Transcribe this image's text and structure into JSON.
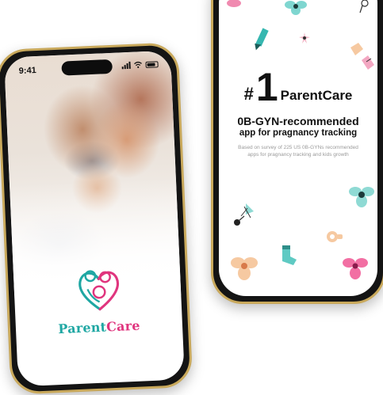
{
  "left_screen": {
    "status": {
      "time": "9:41"
    },
    "brand": {
      "part1": "Parent",
      "part2": "Care"
    }
  },
  "right_screen": {
    "rank": {
      "hash": "#",
      "number": "1",
      "app_name": "ParentCare"
    },
    "headline": "0B-GYN-recommended",
    "subheadline": "app for pragnancy tracking",
    "note": "Based on survey of 225 US 0B-GYNs recommended apps for pragnancy tracking and kids growth"
  },
  "colors": {
    "brand_teal": "#1fa7a3",
    "brand_pink": "#e0357e",
    "frame_gold": "#c9a95c"
  },
  "icons": [
    "pencil-icon",
    "baby-bottle-icon",
    "sock-icon",
    "pacifier-icon",
    "flower-icon",
    "pinwheel-icon",
    "family-heart-logo-icon"
  ]
}
